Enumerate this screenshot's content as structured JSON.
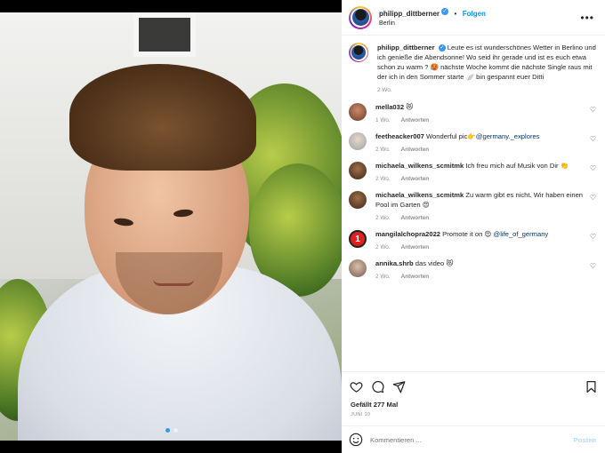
{
  "post": {
    "username": "philipp_dittberner",
    "follow_label": "Folgen",
    "location": "Berlin",
    "more_icon": "more-horizontal-icon",
    "caption_user": "philipp_dittberner",
    "caption_text": "Leute es ist wunderschönes Wetter in Berlino und ich genieße die Abendsonne! Wo seid ihr gerade und ist es euch etwa schon zu warm ? 🥵 nächste Woche kommt die nächste Single raus mit der ich in den Sommer starte 🪽 bin gespannt euer Ditti",
    "caption_time": "2 Wo.",
    "likes": "Gefällt 277 Mal",
    "date": "JUNI 10",
    "comment_placeholder": "Kommentieren ...",
    "post_label": "Posten",
    "accent_color": "#0095f6"
  },
  "comments": [
    {
      "user": "mella032",
      "text": "😻",
      "mention": "",
      "time": "1 Wo.",
      "reply": "Antworten"
    },
    {
      "user": "feetheacker007",
      "text": "Wonderful pic👉",
      "mention": "@germany._explores",
      "time": "2 Wo.",
      "reply": "Antworten"
    },
    {
      "user": "michaela_wilkens_scmitmk",
      "text": "Ich freu mich auf Musik von Dir 👏",
      "mention": "",
      "time": "2 Wo.",
      "reply": "Antworten"
    },
    {
      "user": "michaela_wilkens_scmitmk",
      "text": "Zu warm gibt es nicht. Wir haben einen Pool im Garten 😍",
      "mention": "",
      "time": "2 Wo.",
      "reply": "Antworten"
    },
    {
      "user": "mangilalchopra2022",
      "text": "Promote it on 😍",
      "mention": "@life_of_germany",
      "time": "2 Wo.",
      "reply": "Antworten"
    },
    {
      "user": "annika.shrb",
      "text": "das video 😻",
      "mention": "",
      "time": "2 Wo.",
      "reply": "Antworten"
    }
  ],
  "carousel": {
    "current": 1,
    "total": 2
  }
}
